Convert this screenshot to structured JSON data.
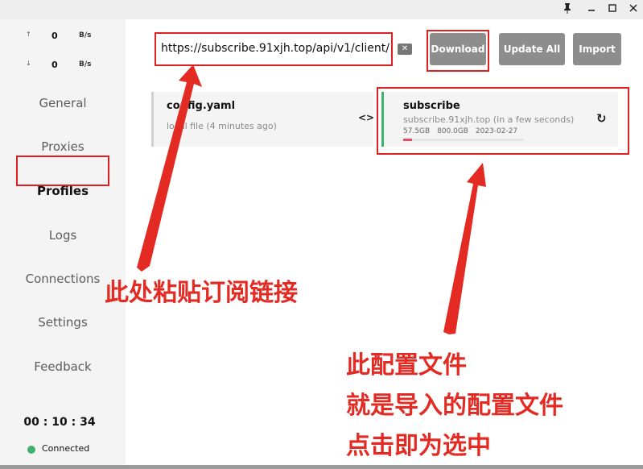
{
  "window": {
    "controls": [
      {
        "name": "pin-icon",
        "glyph": "📌"
      },
      {
        "name": "minimize-icon",
        "glyph": "—"
      },
      {
        "name": "maximize-icon",
        "glyph": "☐"
      },
      {
        "name": "close-icon",
        "glyph": "✕"
      }
    ]
  },
  "traffic": {
    "up_arrow": "↑",
    "up_value": "0",
    "up_unit": "B/s",
    "down_arrow": "↓",
    "down_value": "0",
    "down_unit": "B/s"
  },
  "sidebar": {
    "items": [
      {
        "label": "General",
        "active": false
      },
      {
        "label": "Proxies",
        "active": false
      },
      {
        "label": "Profiles",
        "active": true
      },
      {
        "label": "Logs",
        "active": false
      },
      {
        "label": "Connections",
        "active": false
      },
      {
        "label": "Settings",
        "active": false
      },
      {
        "label": "Feedback",
        "active": false
      }
    ]
  },
  "clock": {
    "time": "00 : 10 : 34",
    "status": "Connected",
    "status_color": "#3fb26d"
  },
  "toolbar": {
    "url_value": "https://subscribe.91xjh.top/api/v1/client/",
    "clear_glyph": "✕",
    "download_label": "Download",
    "update_all_label": "Update All",
    "import_label": "Import"
  },
  "profiles": [
    {
      "title": "config.yaml",
      "subtitle": "local file (4 minutes ago)",
      "icon": "<>"
    },
    {
      "title": "subscribe",
      "subtitle": "subscribe.91xjh.top (in a few seconds)",
      "used": "57.5GB",
      "total": "800.0GB",
      "expire": "2023-02-27",
      "usage_fraction": 0.072,
      "icon": "↻"
    }
  ],
  "annotations": {
    "paste_hint": "此处粘贴订阅链接",
    "profile_hint_line1": "此配置文件",
    "profile_hint_line2": "就是导入的配置文件",
    "profile_hint_line3": "点击即为选中"
  },
  "colors": {
    "accent_red": "#e02020",
    "active_green": "#3fb26d",
    "button_gray": "#8d8d8d"
  }
}
